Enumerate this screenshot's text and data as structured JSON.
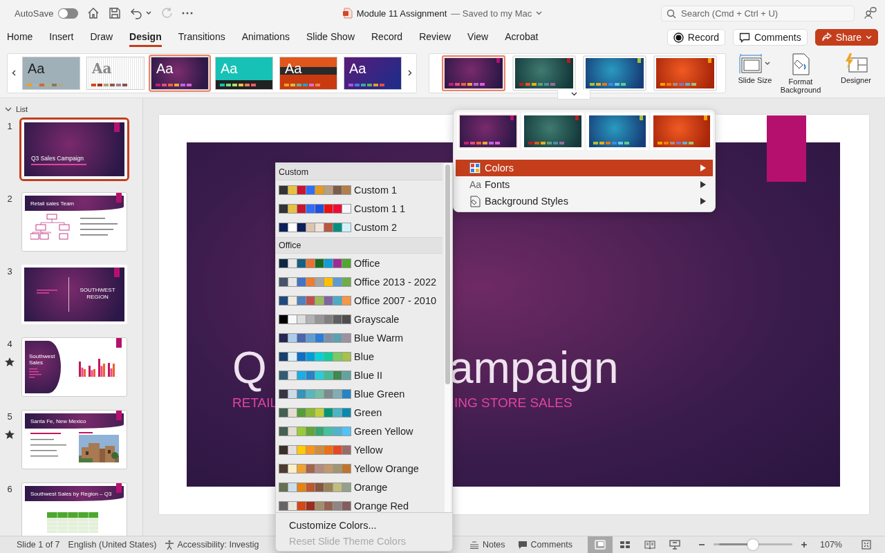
{
  "titlebar": {
    "autosave": {
      "label": "AutoSave",
      "on": false
    },
    "document_title": "Module 11 Assignment",
    "save_status": "— Saved to my Mac",
    "search": {
      "placeholder": "Search (Cmd + Ctrl + U)"
    }
  },
  "tabs": [
    {
      "label": "Home",
      "selected": false
    },
    {
      "label": "Insert",
      "selected": false
    },
    {
      "label": "Draw",
      "selected": false
    },
    {
      "label": "Design",
      "selected": true
    },
    {
      "label": "Transitions",
      "selected": false
    },
    {
      "label": "Animations",
      "selected": false
    },
    {
      "label": "Slide Show",
      "selected": false
    },
    {
      "label": "Record",
      "selected": false
    },
    {
      "label": "Review",
      "selected": false
    },
    {
      "label": "View",
      "selected": false
    },
    {
      "label": "Acrobat",
      "selected": false
    }
  ],
  "actions": [
    {
      "kind": "record",
      "label": "Record"
    },
    {
      "kind": "comments",
      "label": "Comments"
    },
    {
      "kind": "share",
      "label": "Share"
    }
  ],
  "themes": [
    {
      "kind": "gray",
      "label": "Aa",
      "selected": false
    },
    {
      "kind": "texture",
      "label": "Aa",
      "selected": false
    },
    {
      "kind": "purple",
      "label": "Aa",
      "selected": true
    },
    {
      "kind": "teal",
      "label": "Aa",
      "selected": false
    },
    {
      "kind": "orange",
      "label": "Aa",
      "selected": false
    },
    {
      "kind": "violet",
      "label": "Aa",
      "selected": false
    }
  ],
  "variants": [
    {
      "kind": "purple",
      "selected": true
    },
    {
      "kind": "teal",
      "selected": false
    },
    {
      "kind": "blue",
      "selected": false
    },
    {
      "kind": "orange",
      "selected": false
    }
  ],
  "ribbon_buttons": [
    {
      "kind": "slide-size",
      "label": "Slide Size"
    },
    {
      "kind": "format-background",
      "label": "Format Background"
    },
    {
      "kind": "designer",
      "label": "Designer"
    }
  ],
  "pane": {
    "header": "List",
    "slides": [
      {
        "number": "1",
        "selected": true,
        "animated": false,
        "kind": "title",
        "title": "Q3 Sales Campaign"
      },
      {
        "number": "2",
        "selected": false,
        "animated": false,
        "kind": "org",
        "title": "Retail sales Team"
      },
      {
        "number": "3",
        "selected": false,
        "animated": false,
        "kind": "section",
        "title": "SOUTHWEST REGION"
      },
      {
        "number": "4",
        "selected": false,
        "animated": true,
        "kind": "chart",
        "title": "Southwest Sales"
      },
      {
        "number": "5",
        "selected": false,
        "animated": true,
        "title": "Santa Fe, New Mexico"
      },
      {
        "number": "6",
        "selected": false,
        "animated": false,
        "kind": "table",
        "title": "Southwest Sales by Region – Q3"
      }
    ]
  },
  "main_slide": {
    "title_parts": [
      "Q",
      "ampaign"
    ],
    "subtitle_parts": [
      "RETAIL",
      "ING STORE SALES"
    ]
  },
  "variants_menu": {
    "variants": [
      {
        "kind": "purple",
        "selected": true
      },
      {
        "kind": "teal",
        "selected": false
      },
      {
        "kind": "blue",
        "selected": false
      },
      {
        "kind": "orange",
        "selected": false
      }
    ],
    "items": [
      {
        "kind": "colors",
        "label": "Colors",
        "selected": true,
        "submenu": true
      },
      {
        "kind": "fonts",
        "icon_text": "Aa",
        "label": "Fonts",
        "selected": false,
        "submenu": true
      },
      {
        "kind": "background",
        "label": "Background Styles",
        "selected": false,
        "submenu": true
      }
    ]
  },
  "colors_menu": {
    "groups": [
      {
        "header": "Custom",
        "schemes": [
          {
            "name": "Custom 1",
            "colors": [
              {
                "color": "#333333"
              },
              {
                "color": "#e6c040"
              },
              {
                "color": "#c8152f"
              },
              {
                "color": "#2f6ef5"
              },
              {
                "color": "#e59a22"
              },
              {
                "color": "#b59f80"
              },
              {
                "color": "#7e5c4c"
              },
              {
                "color": "#b07f4a"
              }
            ]
          },
          {
            "name": "Custom 1 1",
            "colors": [
              {
                "color": "#333333"
              },
              {
                "color": "#e6c040"
              },
              {
                "color": "#c8152f"
              },
              {
                "color": "#2f6ef5"
              },
              {
                "color": "#1e50e0"
              },
              {
                "color": "#ee1010"
              },
              {
                "color": "#f00a3a"
              },
              {
                "color": "#f5f5fb"
              }
            ]
          },
          {
            "name": "Custom 2",
            "colors": [
              {
                "color": "#0c1f5a"
              },
              {
                "color": "#ffffff"
              },
              {
                "color": "#0c1f5a"
              },
              {
                "color": "#dcc5ae"
              },
              {
                "color": "#f0e4da"
              },
              {
                "color": "#b95640"
              },
              {
                "color": "#009080"
              },
              {
                "color": "#d0f3fb"
              }
            ]
          }
        ]
      },
      {
        "header": "Office",
        "schemes": [
          {
            "name": "Office",
            "colors": [
              {
                "color": "#0e2841"
              },
              {
                "color": "#e8e8e8"
              },
              {
                "color": "#156082"
              },
              {
                "color": "#e97132"
              },
              {
                "color": "#196b24"
              },
              {
                "color": "#0f9ed5"
              },
              {
                "color": "#a02b93"
              },
              {
                "color": "#4ea72e"
              }
            ]
          },
          {
            "name": "Office 2013 - 2022",
            "colors": [
              {
                "color": "#44546a"
              },
              {
                "color": "#e7e6e6"
              },
              {
                "color": "#4472c4"
              },
              {
                "color": "#ed7d31"
              },
              {
                "color": "#a5a5a5"
              },
              {
                "color": "#ffc000"
              },
              {
                "color": "#5b9bd5"
              },
              {
                "color": "#70ad47"
              }
            ]
          },
          {
            "name": "Office 2007 - 2010",
            "colors": [
              {
                "color": "#1f497d"
              },
              {
                "color": "#eeece1"
              },
              {
                "color": "#4f81bd"
              },
              {
                "color": "#c0504d"
              },
              {
                "color": "#9bbb59"
              },
              {
                "color": "#8064a2"
              },
              {
                "color": "#4bacc6"
              },
              {
                "color": "#f79646"
              }
            ]
          },
          {
            "name": "Grayscale",
            "colors": [
              {
                "color": "#000000"
              },
              {
                "color": "#f8f8f8"
              },
              {
                "color": "#dddddd"
              },
              {
                "color": "#b2b2b2"
              },
              {
                "color": "#969696"
              },
              {
                "color": "#808080"
              },
              {
                "color": "#5f5f5f"
              },
              {
                "color": "#4d4d4d"
              }
            ]
          },
          {
            "name": "Blue Warm",
            "colors": [
              {
                "color": "#242852"
              },
              {
                "color": "#acccea"
              },
              {
                "color": "#4a66ac"
              },
              {
                "color": "#629dd1"
              },
              {
                "color": "#297fd5"
              },
              {
                "color": "#7f8fa9"
              },
              {
                "color": "#5aa2ae"
              },
              {
                "color": "#9d90a0"
              }
            ]
          },
          {
            "name": "Blue",
            "colors": [
              {
                "color": "#17406d"
              },
              {
                "color": "#dbeff9"
              },
              {
                "color": "#0f6fc6"
              },
              {
                "color": "#009dd9"
              },
              {
                "color": "#0bd0d9"
              },
              {
                "color": "#10cf9b"
              },
              {
                "color": "#7cca62"
              },
              {
                "color": "#a5c249"
              }
            ]
          },
          {
            "name": "Blue II",
            "colors": [
              {
                "color": "#335b74"
              },
              {
                "color": "#dfe3e5"
              },
              {
                "color": "#1cade4"
              },
              {
                "color": "#2683c6"
              },
              {
                "color": "#27ced7"
              },
              {
                "color": "#42ba97"
              },
              {
                "color": "#3e8853"
              },
              {
                "color": "#62a39f"
              }
            ]
          },
          {
            "name": "Blue Green",
            "colors": [
              {
                "color": "#373545"
              },
              {
                "color": "#cedbe6"
              },
              {
                "color": "#3494ba"
              },
              {
                "color": "#58b6c0"
              },
              {
                "color": "#75bda7"
              },
              {
                "color": "#7a8c8e"
              },
              {
                "color": "#84acb6"
              },
              {
                "color": "#2683c6"
              }
            ]
          },
          {
            "name": "Green",
            "colors": [
              {
                "color": "#455f51"
              },
              {
                "color": "#e3ded1"
              },
              {
                "color": "#549e39"
              },
              {
                "color": "#8ab833"
              },
              {
                "color": "#c0cf3a"
              },
              {
                "color": "#029676"
              },
              {
                "color": "#4ab5c4"
              },
              {
                "color": "#0989b1"
              }
            ]
          },
          {
            "name": "Green Yellow",
            "colors": [
              {
                "color": "#455f51"
              },
              {
                "color": "#e3ded1"
              },
              {
                "color": "#99cb38"
              },
              {
                "color": "#63a537"
              },
              {
                "color": "#37a76f"
              },
              {
                "color": "#44c1a3"
              },
              {
                "color": "#4eb3cf"
              },
              {
                "color": "#51c3f9"
              }
            ]
          },
          {
            "name": "Yellow",
            "colors": [
              {
                "color": "#39302a"
              },
              {
                "color": "#e5dedb"
              },
              {
                "color": "#ffca08"
              },
              {
                "color": "#f8931d"
              },
              {
                "color": "#ce8d3e"
              },
              {
                "color": "#ec7016"
              },
              {
                "color": "#e64823"
              },
              {
                "color": "#9c6a6a"
              }
            ]
          },
          {
            "name": "Yellow Orange",
            "colors": [
              {
                "color": "#4e3b30"
              },
              {
                "color": "#fbeec9"
              },
              {
                "color": "#f0a22e"
              },
              {
                "color": "#a5644e"
              },
              {
                "color": "#b58b80"
              },
              {
                "color": "#c3986d"
              },
              {
                "color": "#a19574"
              },
              {
                "color": "#c17529"
              }
            ]
          },
          {
            "name": "Orange",
            "colors": [
              {
                "color": "#637052"
              },
              {
                "color": "#ccddea"
              },
              {
                "color": "#e48312"
              },
              {
                "color": "#bd582c"
              },
              {
                "color": "#865640"
              },
              {
                "color": "#9b8357"
              },
              {
                "color": "#c2bc80"
              },
              {
                "color": "#94a088"
              }
            ]
          },
          {
            "name": "Orange Red",
            "colors": [
              {
                "color": "#696464"
              },
              {
                "color": "#e9e5dc"
              },
              {
                "color": "#d34817"
              },
              {
                "color": "#9b2d1f"
              },
              {
                "color": "#a28e6a"
              },
              {
                "color": "#956251"
              },
              {
                "color": "#918485"
              },
              {
                "color": "#855d5d"
              }
            ]
          }
        ]
      }
    ],
    "footer": [
      {
        "label": "Customize Colors...",
        "disabled": false
      },
      {
        "label": "Reset Slide Theme Colors",
        "disabled": true
      }
    ]
  },
  "status_bar": {
    "slide": "Slide 1 of 7",
    "language": "English (United States)",
    "accessibility": "Accessibility: Investig",
    "notes": "Notes",
    "comments": "Comments",
    "views": [
      {
        "kind": "normal",
        "selected": true
      },
      {
        "kind": "sorter",
        "selected": false
      },
      {
        "kind": "reading",
        "selected": false
      },
      {
        "kind": "slideshow",
        "selected": false
      }
    ],
    "zoom": {
      "level": 0.5,
      "reading": "107%"
    }
  }
}
